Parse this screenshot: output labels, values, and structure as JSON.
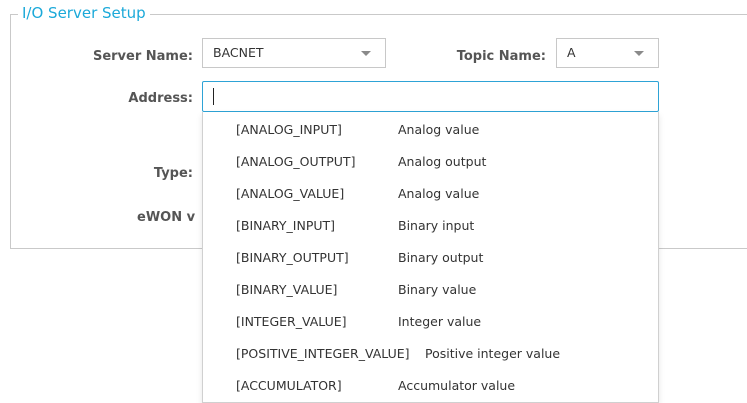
{
  "section": {
    "legend": "I/O Server Setup"
  },
  "form": {
    "server_name_label": "Server Name:",
    "server_name_value": "BACNET",
    "topic_name_label": "Topic Name:",
    "topic_name_value": "A",
    "address_label": "Address:",
    "address_value": "",
    "type_label": "Type:",
    "ewon_label_visible": "eWON v"
  },
  "address_options": [
    {
      "code": "[ANALOG_INPUT]",
      "description": "Analog value"
    },
    {
      "code": "[ANALOG_OUTPUT]",
      "description": "Analog output"
    },
    {
      "code": "[ANALOG_VALUE]",
      "description": "Analog value"
    },
    {
      "code": "[BINARY_INPUT]",
      "description": "Binary input"
    },
    {
      "code": "[BINARY_OUTPUT]",
      "description": "Binary output"
    },
    {
      "code": "[BINARY_VALUE]",
      "description": "Binary value"
    },
    {
      "code": "[INTEGER_VALUE]",
      "description": "Integer value"
    },
    {
      "code": "[POSITIVE_INTEGER_VALUE]",
      "description": "Positive integer value"
    },
    {
      "code": "[ACCUMULATOR]",
      "description": "Accumulator value"
    }
  ],
  "colors": {
    "accent": "#1ba9d9",
    "input_focus_border": "#2ea3d6",
    "border": "#c9c9c9"
  },
  "icons": {
    "select_caret": "caret-down-icon"
  }
}
